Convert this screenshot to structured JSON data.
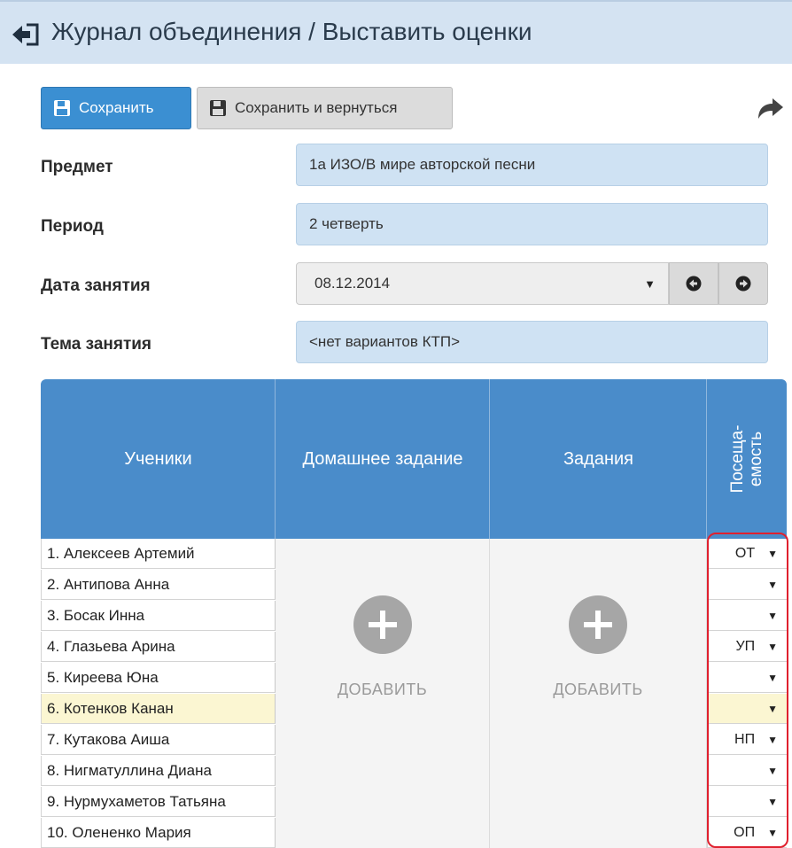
{
  "header": {
    "title": "Журнал объединения / Выставить оценки",
    "back_icon": "back-arrow-icon"
  },
  "toolbar": {
    "save_label": "Сохранить",
    "save_return_label": "Сохранить и вернуться",
    "save_icon": "save-icon",
    "share_icon": "share-arrow-icon"
  },
  "form": {
    "subject_label": "Предмет",
    "subject_value": "1а ИЗО/В мире авторской песни",
    "period_label": "Период",
    "period_value": "2 четверть",
    "date_label": "Дата занятия",
    "date_value": "08.12.2014",
    "topic_label": "Тема занятия",
    "topic_value": "<нет вариантов КТП>"
  },
  "table": {
    "headers": {
      "students": "Ученики",
      "homework": "Домашнее задание",
      "tasks": "Задания",
      "attendance_1": "Посеща-",
      "attendance_2": "емость"
    },
    "add_label": "ДОБАВИТЬ",
    "students": [
      {
        "name": "1. Алексеев Артемий",
        "attendance": "ОТ"
      },
      {
        "name": "2. Антипова Анна",
        "attendance": ""
      },
      {
        "name": "3. Босак Инна",
        "attendance": ""
      },
      {
        "name": "4. Глазьева Арина",
        "attendance": "УП"
      },
      {
        "name": "5. Киреева Юна",
        "attendance": ""
      },
      {
        "name": "6. Котенков Канан",
        "attendance": ""
      },
      {
        "name": "7. Кутакова Аиша",
        "attendance": "НП"
      },
      {
        "name": "8. Нигматуллина Диана",
        "attendance": ""
      },
      {
        "name": "9. Нурмухаметов Татьяна",
        "attendance": ""
      },
      {
        "name": "10. Олененко Мария",
        "attendance": "ОП"
      }
    ]
  },
  "colors": {
    "header_bg": "#d4e3f2",
    "primary": "#3b8fd2",
    "table_head": "#4a8cca",
    "field_bg": "#cfe2f3",
    "highlight_row": "#fbf6d2",
    "annotation": "#e0202e"
  }
}
